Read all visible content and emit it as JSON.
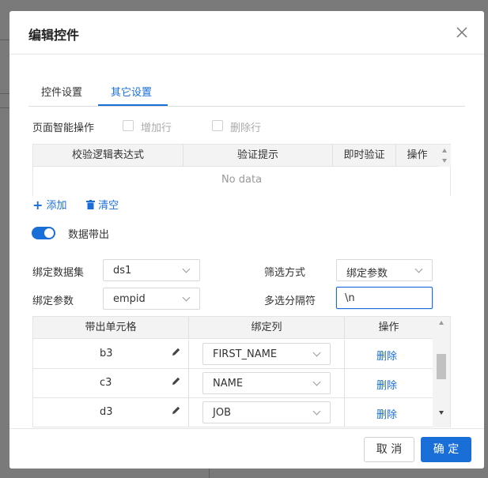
{
  "dialog": {
    "title": "编辑控件"
  },
  "tabs": [
    {
      "label": "控件设置",
      "active": false
    },
    {
      "label": "其它设置",
      "active": true
    }
  ],
  "smart_ops": {
    "label": "页面智能操作",
    "add_row": {
      "label": "增加行",
      "checked": false
    },
    "delete_row": {
      "label": "删除行",
      "checked": false
    }
  },
  "validation_grid": {
    "columns": [
      "校验逻辑表达式",
      "验证提示",
      "即时验证",
      "操作"
    ],
    "empty_text": "No data"
  },
  "grid_actions": {
    "add": "添加",
    "clear": "清空"
  },
  "data_out": {
    "label": "数据带出",
    "enabled": true
  },
  "form": {
    "dataset_label": "绑定数据集",
    "dataset_value": "ds1",
    "filter_label": "筛选方式",
    "filter_value": "绑定参数",
    "param_label": "绑定参数",
    "param_value": "empid",
    "separator_label": "多选分隔符",
    "separator_value": "\\n"
  },
  "mapping_grid": {
    "columns": [
      "带出单元格",
      "绑定列",
      "操作"
    ],
    "rows": [
      {
        "cell": "b3",
        "column": "FIRST_NAME",
        "action": "删除"
      },
      {
        "cell": "c3",
        "column": "NAME",
        "action": "删除"
      },
      {
        "cell": "d3",
        "column": "JOB",
        "action": "删除"
      }
    ]
  },
  "footer": {
    "cancel": "取 消",
    "confirm": "确 定"
  },
  "colors": {
    "accent": "#1a6ed8",
    "backdrop": "#7a7a7a"
  }
}
